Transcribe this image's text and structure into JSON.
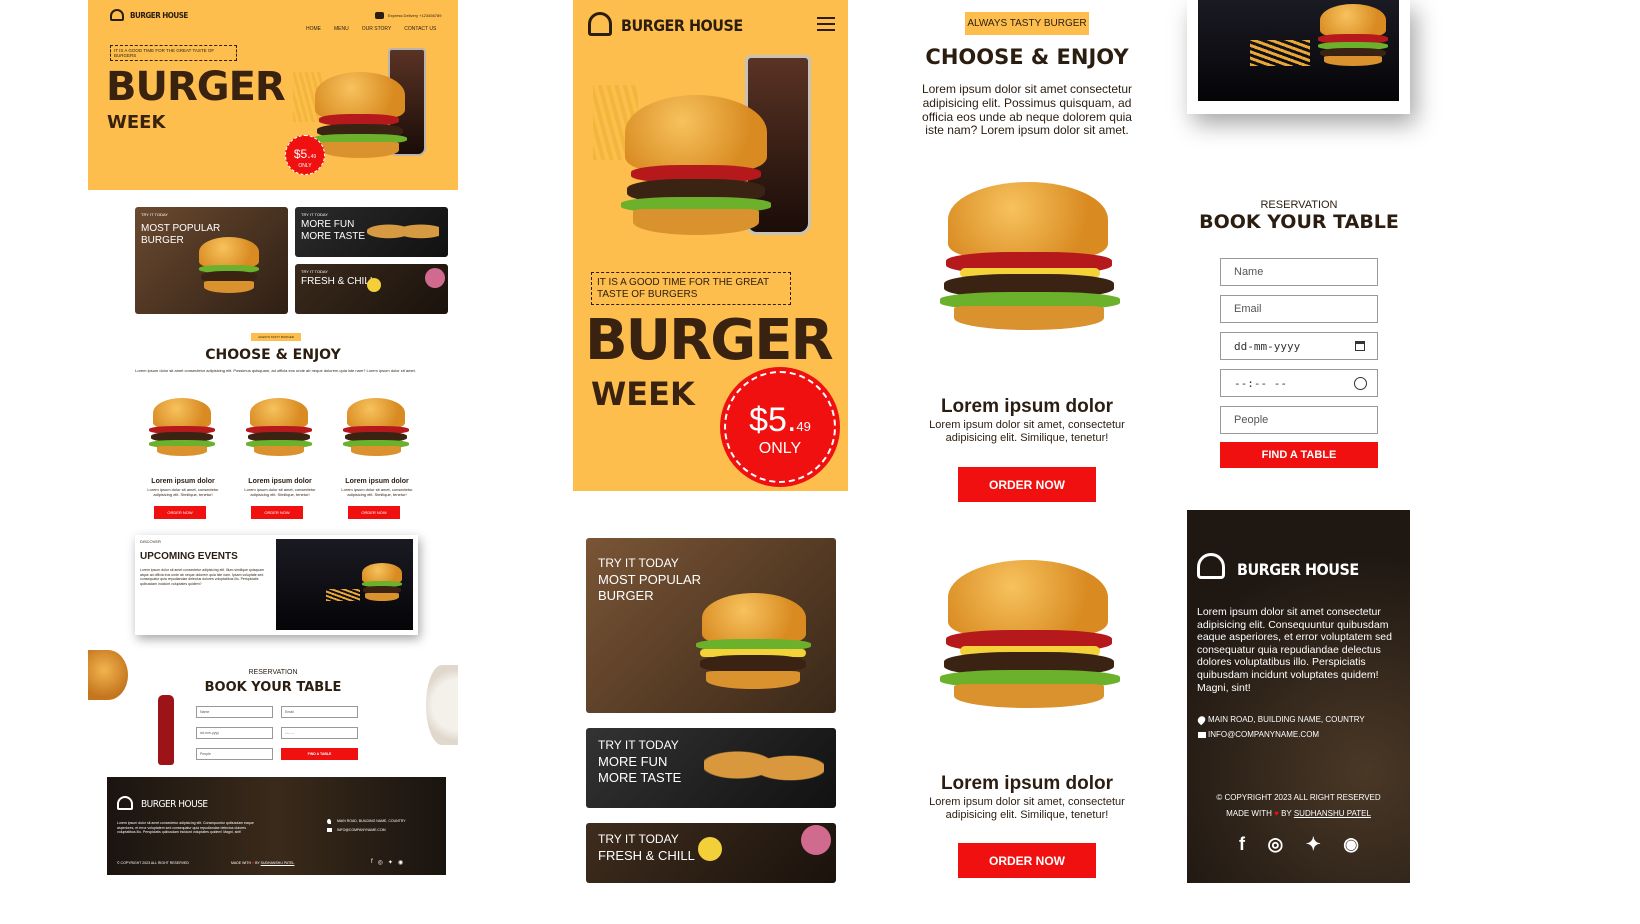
{
  "brand": {
    "name": "BURGER HOUSE"
  },
  "nav": {
    "items": [
      "HOME",
      "MENU",
      "OUR STORY",
      "CONTACT US"
    ],
    "delivery": "Express Delivery +123456789"
  },
  "hero": {
    "tagline": "IT IS A GOOD TIME FOR THE GREAT TASTE OF BURGERS",
    "title": "BURGER",
    "subtitle": "WEEK",
    "price_main": "$5.",
    "price_cents": "49",
    "price_note": "ONLY"
  },
  "promo_cards": [
    {
      "kicker": "TRY IT TODAY",
      "title": "MOST POPULAR BURGER"
    },
    {
      "kicker": "TRY IT TODAY",
      "title": "MORE FUN MORE TASTE"
    },
    {
      "kicker": "TRY IT TODAY",
      "title": "FRESH & CHILL"
    }
  ],
  "choose": {
    "badge": "ALWAYS TASTY BURGER",
    "title": "CHOOSE & ENJOY",
    "text": "Lorem ipsum dolor sit amet consectetur adipisicing elit. Possimus quisquam, ad officia eos unde ab neque dolorem quia iste nam? Lorem ipsum dolor sit amet.",
    "text_short": "Lorem ipsum dolor sit amet consectetur adipisicing elit. Possimus quisquam, ad officia eos unde ab neque dolorem quia iste nam? Lorem ipsum dolor sit amet."
  },
  "products": [
    {
      "name": "Lorem ipsum dolor",
      "desc": "Lorem ipsum dolor sit amet, consectetur adipisicing elit. Similique, tenetur!",
      "button": "ORDER NOW"
    },
    {
      "name": "Lorem ipsum dolor",
      "desc": "Lorem ipsum dolor sit amet, consectetur adipisicing elit. Similique, tenetur!",
      "button": "ORDER NOW"
    },
    {
      "name": "Lorem ipsum dolor",
      "desc": "Lorem ipsum dolor sit amet, consectetur adipisicing elit. Similique, tenetur!",
      "button": "ORDER NOW"
    }
  ],
  "events": {
    "kicker": "DISCOVER",
    "title": "UPCOMING EVENTS",
    "text": "Lorem ipsum dolor sit amet consectetur adipisicing elit. Illum similique quisquam atque ad officia eos unde ab neque dolorem quia iste nam. Ipsam voluptate sed consequatur quia repudiandae delectus dolores voluptatibus illo. Perspiciatis quibusdam incidunt voluptates quidem?"
  },
  "reservation": {
    "kicker": "RESERVATION",
    "title": "BOOK YOUR TABLE",
    "name_placeholder": "Name",
    "email_placeholder": "Email",
    "date_placeholder": "dd-mm-yyyy",
    "time_placeholder": "--:-- --",
    "people_placeholder": "People",
    "button": "FIND A TABLE"
  },
  "footer": {
    "text": "Lorem ipsum dolor sit amet consectetur adipisicing elit. Consequuntur quibusdam eaque asperiores, et error voluptatem sed consequatur quia repudiandae delectus dolores voluptatibus illo. Perspiciatis quibusdam incidunt voluptates quidem! Magni, sint!",
    "address": "MAIN ROAD, BUILDING NAME, COUNTRY",
    "email": "INFO@COMPANYNAME.COM",
    "copyright": "© COPYRIGHT 2023 ALL RIGHT RESERVED",
    "copyright_small": "© COPYRIGHT 2023 ALL RIGHT RESERVED",
    "made_with": "MADE WITH",
    "by": "BY",
    "author": "SUDHANSHU PATEL"
  },
  "colors": {
    "accent": "#fdbe4e",
    "red": "#f01010",
    "dark": "#2b1d10"
  }
}
